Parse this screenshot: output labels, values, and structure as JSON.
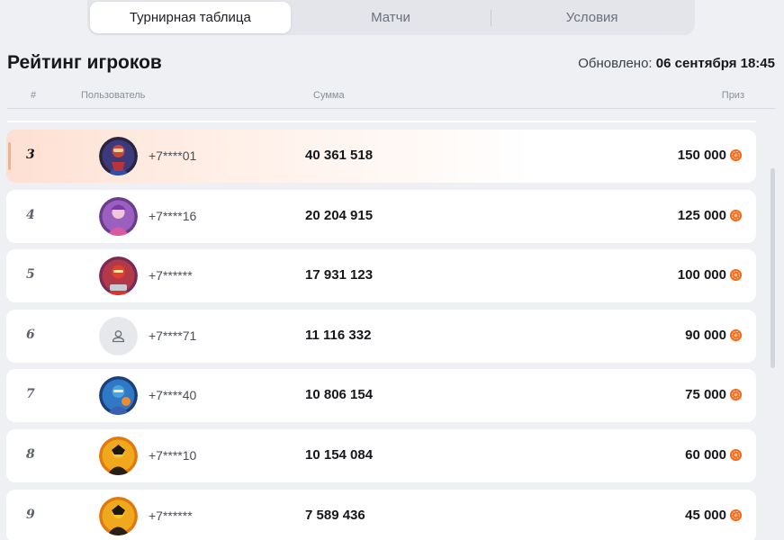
{
  "tabs": [
    {
      "label": "Турнирная таблица",
      "active": true
    },
    {
      "label": "Матчи",
      "active": false
    },
    {
      "label": "Условия",
      "active": false
    }
  ],
  "header": {
    "title": "Рейтинг игроков",
    "updated_label": "Обновлено:",
    "updated_value": "06 сентября 18:45"
  },
  "columns": {
    "num": "#",
    "user": "Пользователь",
    "sum": "Сумма",
    "prize": "Приз"
  },
  "rows": [
    {
      "rank": "3",
      "phone": "+7****01",
      "sum": "40 361 518",
      "prize": "150 000",
      "avatar": "hero-blue-red",
      "highlight": true
    },
    {
      "rank": "4",
      "phone": "+7****16",
      "sum": "20 204 915",
      "prize": "125 000",
      "avatar": "hero-purple-pink",
      "highlight": false
    },
    {
      "rank": "5",
      "phone": "+7******",
      "sum": "17 931 123",
      "prize": "100 000",
      "avatar": "hero-red",
      "highlight": false
    },
    {
      "rank": "6",
      "phone": "+7****71",
      "sum": "11 116 332",
      "prize": "90 000",
      "avatar": "default-user-icon",
      "highlight": false
    },
    {
      "rank": "7",
      "phone": "+7****40",
      "sum": "10 806 154",
      "prize": "75 000",
      "avatar": "hero-blue-orange",
      "highlight": false
    },
    {
      "rank": "8",
      "phone": "+7****10",
      "sum": "10 154 084",
      "prize": "60 000",
      "avatar": "hero-yellow-black",
      "highlight": false
    },
    {
      "rank": "9",
      "phone": "+7******",
      "sum": "7 589 436",
      "prize": "45 000",
      "avatar": "hero-yellow-black",
      "highlight": false
    }
  ],
  "colors": {
    "coin": "#f26a1b",
    "highlight": "#fde0d2",
    "accent_bar": "#f3b08f"
  }
}
